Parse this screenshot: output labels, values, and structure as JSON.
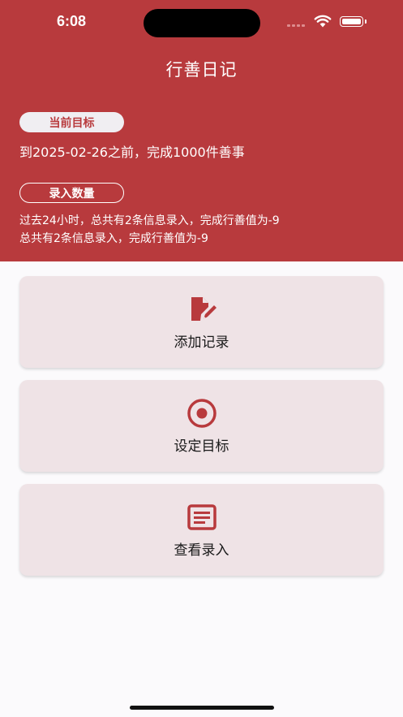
{
  "status_bar": {
    "time": "6:08"
  },
  "header": {
    "title": "行善日记",
    "goal_badge": "当前目标",
    "goal_text": "到2025-02-26之前，完成1000件善事",
    "count_badge": "录入数量",
    "count_line_1": "过去24小时，总共有2条信息录入，完成行善值为-9",
    "count_line_2": "总共有2条信息录入，完成行善值为-9"
  },
  "cards": [
    {
      "label": "添加记录",
      "icon": "edit-document-icon"
    },
    {
      "label": "设定目标",
      "icon": "target-icon"
    },
    {
      "label": "查看录入",
      "icon": "list-document-icon"
    }
  ],
  "colors": {
    "primary": "#b83a3d",
    "card_bg": "#efe3e6",
    "page_bg": "#fbfafc",
    "badge_bg": "#f0eef2"
  }
}
